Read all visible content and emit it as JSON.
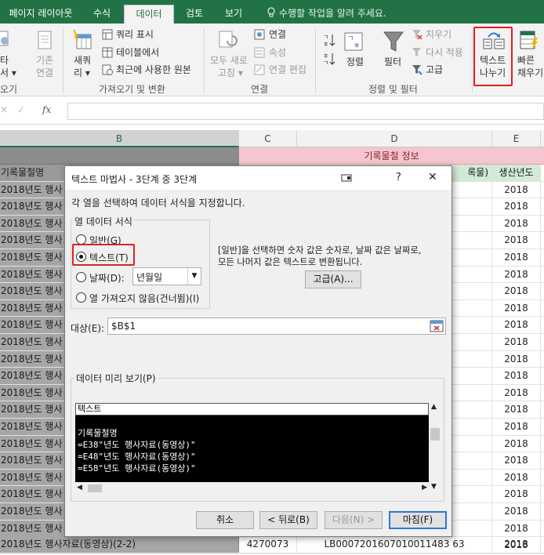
{
  "ribbon": {
    "tabs": [
      {
        "label": "페이지 레이아웃",
        "active": false
      },
      {
        "label": "수식",
        "active": false
      },
      {
        "label": "데이터",
        "active": true
      },
      {
        "label": "검토",
        "active": false
      },
      {
        "label": "보기",
        "active": false
      }
    ],
    "tell_me": "수행할 작업을 알려 주세요.",
    "partial_left": {
      "line1": "타",
      "line2": "서 ▾",
      "line3": "오기"
    },
    "basic_connection": {
      "line1": "기존",
      "line2": "연결"
    },
    "new_query": {
      "line1": "새쿼",
      "line2": "리 ▾"
    },
    "query_show": "쿼리 표시",
    "from_table": "테이블에서",
    "recent_sources": "최근에 사용한 원본",
    "group_get_transform": "가져오기 및 변환",
    "refresh_all": {
      "line1": "모두 새로",
      "line2": "고침 ▾"
    },
    "connections": "연결",
    "properties": "속성",
    "edit_links": "연결 편집",
    "group_connections": "연결",
    "sort_label": "정렬",
    "filter_label": "필터",
    "clear": "지우기",
    "reapply": "다시 적용",
    "advanced": "고급",
    "group_sort_filter": "정렬 및 필터",
    "text_to_columns": {
      "line1": "텍스트",
      "line2": "나누기"
    },
    "flash_fill": {
      "line1": "빠른",
      "line2": "채우기"
    }
  },
  "formula_bar": {
    "cancel": "✕",
    "enter": "✓",
    "fx": "fx"
  },
  "columns": {
    "B": "B",
    "C": "C",
    "D": "D",
    "E": "E"
  },
  "grid": {
    "group_header": "기록물철 정보",
    "header_row": {
      "b": "기록물철명",
      "d_tail": "록물)",
      "e": "생산년도"
    },
    "rows": [
      {
        "b": "2018년도 행사",
        "e": "2018"
      },
      {
        "b": "2018년도 행사",
        "e": "2018"
      },
      {
        "b": "2018년도 행사",
        "e": "2018"
      },
      {
        "b": "2018년도 행사",
        "e": "2018"
      },
      {
        "b": "2018년도 행사",
        "e": "2018"
      },
      {
        "b": "2018년도 행사",
        "e": "2018"
      },
      {
        "b": "2018년도 행사",
        "e": "2018"
      },
      {
        "b": "2018년도 행사",
        "e": "2018"
      },
      {
        "b": "2018년도 행사",
        "e": "2018"
      },
      {
        "b": "2018년도 행사",
        "e": "2018"
      },
      {
        "b": "2018년도 행사",
        "e": "2018"
      },
      {
        "b": "2018년도 행사",
        "e": "2018"
      },
      {
        "b": "2018년도 행사",
        "e": "2018"
      },
      {
        "b": "2018년도 행사",
        "e": "2018"
      },
      {
        "b": "2018년도 행사",
        "e": "2018"
      },
      {
        "b": "2018년도 행사",
        "e": "2018"
      },
      {
        "b": "2018년도 행사",
        "e": "2018"
      },
      {
        "b": "2018년도 행사",
        "e": "2018"
      },
      {
        "b": "2018년도 행사",
        "e": "2018"
      },
      {
        "b": "2018년도 행사",
        "e": "2018"
      },
      {
        "b": "2018년도 행사",
        "e": "2018"
      },
      {
        "b": "2018년도 행사",
        "e": "2018"
      }
    ],
    "last_row": {
      "b": "2018년도 행사자료(동영상)(2-2)",
      "c": "4270073",
      "d": "LB0007201607010011483 63",
      "e": "2018"
    }
  },
  "dialog": {
    "title": "텍스트 마법사 - 3단계 중 3단계",
    "help": "?",
    "close": "✕",
    "instruction": "각 열을 선택하여 데이터 서식을 지정합니다.",
    "column_format_legend": "열 데이터 서식",
    "options": [
      {
        "label": "일반(G)",
        "selected": false
      },
      {
        "label": "텍스트(T)",
        "selected": true
      },
      {
        "label": "날짜(D):",
        "selected": false
      },
      {
        "label": "열 가져오지 않음(건너뜀)(I)",
        "selected": false
      }
    ],
    "date_format": "년월일",
    "description_line1": "[일반]을 선택하면 숫자 값은 숫자로, 날짜 값은 날짜로,",
    "description_line2": "모든 나머지 값은 텍스트로 변환됩니다.",
    "advanced_button": "고급(A)...",
    "destination_label": "대상(E):",
    "destination_value": "$B$1",
    "preview_label": "데이터 미리 보기(P)",
    "preview_header": "텍스트",
    "preview_lines": [
      "기록물철명",
      "=E38\"년도 행사자료(동영상)\"",
      "=E48\"년도 행사자료(동영상)\"",
      "=E58\"년도 행사자료(동영상)\""
    ],
    "buttons": {
      "cancel": "취소",
      "back": "< 뒤로(B)",
      "next": "다음(N) >",
      "finish": "마침(F)"
    }
  },
  "colors": {
    "excel_green": "#217346",
    "highlight_red": "#e02020",
    "header_pink": "#f4c6cf"
  }
}
